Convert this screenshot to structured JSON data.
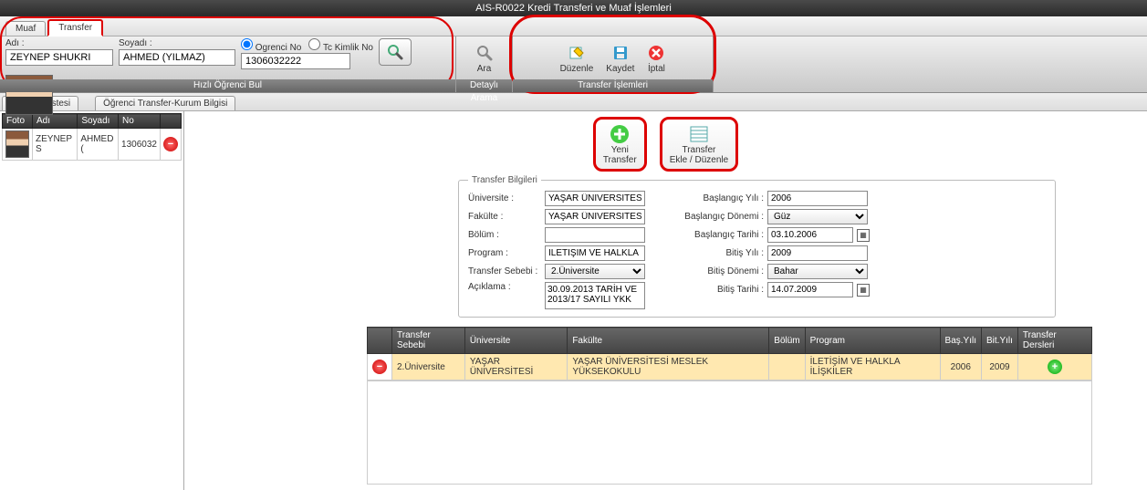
{
  "title": "AIS-R0022 Kredi Transferi ve Muaf İşlemleri",
  "tabs": {
    "muaf": "Muaf",
    "transfer": "Transfer"
  },
  "search": {
    "adi_label": "Adı :",
    "soyadi_label": "Soyadı :",
    "adi": "ZEYNEP SHUKRI",
    "soyadi": "AHMED (YILMAZ)",
    "ogrenci_no_label": "Ogrenci No",
    "tc_kimlik_label": "Tc Kimlik No",
    "ogrenci_no": "1306032222",
    "section_label": "Hızlı Öğrenci Bul"
  },
  "detayli": {
    "label": "Ara",
    "section": "Detaylı Arama"
  },
  "transfer_toolbar": {
    "duzenle": "Düzenle",
    "kaydet": "Kaydet",
    "iptal": "İptal",
    "section": "Transfer İşlemleri"
  },
  "subtabs": {
    "ogrenci_listesi": "Öğrenci Listesi",
    "transfer_kurum": "Öğrenci Transfer-Kurum Bilgisi"
  },
  "student_list": {
    "headers": {
      "foto": "Foto",
      "adi": "Adı",
      "soyadi": "Soyadı",
      "no": "No"
    },
    "row": {
      "adi": "ZEYNEP S",
      "soyadi": "AHMED (",
      "no": "1306032"
    }
  },
  "actions": {
    "yeni_transfer": "Yeni\nTransfer",
    "transfer_ekle": "Transfer\nEkle / Düzenle"
  },
  "form": {
    "legend": "Transfer Bilgileri",
    "universite_label": "Üniversite :",
    "universite": "YAŞAR ÜNİVERSİTESİ",
    "fakulte_label": "Fakülte   :",
    "fakulte": "YAŞAR ÜNİVERSİTESİ ME",
    "bolum_label": "Bölüm    :",
    "bolum": "",
    "program_label": "Program  :",
    "program": "İLETİŞİM VE HALKLA İLİŞ",
    "sebep_label": "Transfer Sebebi :",
    "sebep": "2.Üniversite",
    "aciklama_label": "Açıklama :",
    "aciklama": "30.09.2013 TARİH VE 2013/17 SAYILI YKK",
    "bas_yili_label": "Başlangıç Yılı :",
    "bas_yili": "2006",
    "bas_donemi_label": "Başlangıç Dönemi :",
    "bas_donemi": "Güz",
    "bas_tarih_label": "Başlangıç Tarihi :",
    "bas_tarih": "03.10.2006",
    "bit_yili_label": "Bitiş Yılı :",
    "bit_yili": "2009",
    "bit_donemi_label": "Bitiş Dönemi :",
    "bit_donemi": "Bahar",
    "bit_tarih_label": "Bitiş Tarihi :",
    "bit_tarih": "14.07.2009"
  },
  "grid": {
    "headers": {
      "sebep": "Transfer Sebebi",
      "uni": "Üniversite",
      "fak": "Fakülte",
      "bolum": "Bölüm",
      "program": "Program",
      "basyil": "Baş.Yılı",
      "bityil": "Bit.Yılı",
      "dersler": "Transfer Dersleri"
    },
    "row": {
      "sebep": "2.Üniversite",
      "uni": "YAŞAR ÜNİVERSİTESİ",
      "fak": "YAŞAR ÜNİVERSİTESİ MESLEK YÜKSEKOKULU",
      "bolum": "",
      "program": "İLETİŞİM VE HALKLA İLİŞKİLER",
      "basyil": "2006",
      "bityil": "2009"
    }
  }
}
